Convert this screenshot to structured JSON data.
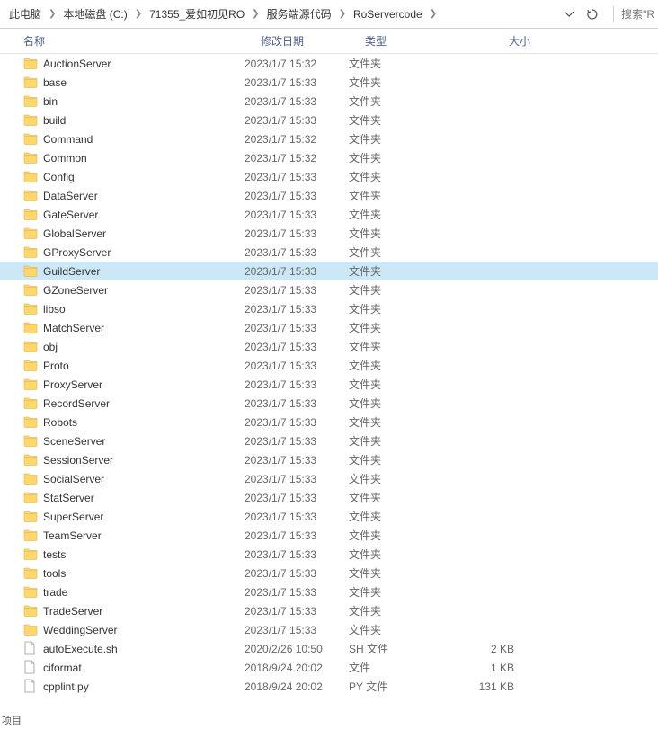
{
  "breadcrumb": {
    "items": [
      "此电脑",
      "本地磁盘 (C:)",
      "71355_爱如初见RO",
      "服务端源代码",
      "RoServercode"
    ]
  },
  "search": {
    "placeholder": "搜索\"R"
  },
  "columns": {
    "name": "名称",
    "date": "修改日期",
    "type": "类型",
    "size": "大小"
  },
  "rows": [
    {
      "icon": "folder",
      "name": "AuctionServer",
      "date": "2023/1/7 15:32",
      "type": "文件夹",
      "size": "",
      "selected": false
    },
    {
      "icon": "folder",
      "name": "base",
      "date": "2023/1/7 15:33",
      "type": "文件夹",
      "size": "",
      "selected": false
    },
    {
      "icon": "folder",
      "name": "bin",
      "date": "2023/1/7 15:33",
      "type": "文件夹",
      "size": "",
      "selected": false
    },
    {
      "icon": "folder",
      "name": "build",
      "date": "2023/1/7 15:33",
      "type": "文件夹",
      "size": "",
      "selected": false
    },
    {
      "icon": "folder",
      "name": "Command",
      "date": "2023/1/7 15:32",
      "type": "文件夹",
      "size": "",
      "selected": false
    },
    {
      "icon": "folder",
      "name": "Common",
      "date": "2023/1/7 15:32",
      "type": "文件夹",
      "size": "",
      "selected": false
    },
    {
      "icon": "folder",
      "name": "Config",
      "date": "2023/1/7 15:33",
      "type": "文件夹",
      "size": "",
      "selected": false
    },
    {
      "icon": "folder",
      "name": "DataServer",
      "date": "2023/1/7 15:33",
      "type": "文件夹",
      "size": "",
      "selected": false
    },
    {
      "icon": "folder",
      "name": "GateServer",
      "date": "2023/1/7 15:33",
      "type": "文件夹",
      "size": "",
      "selected": false
    },
    {
      "icon": "folder",
      "name": "GlobalServer",
      "date": "2023/1/7 15:33",
      "type": "文件夹",
      "size": "",
      "selected": false
    },
    {
      "icon": "folder",
      "name": "GProxyServer",
      "date": "2023/1/7 15:33",
      "type": "文件夹",
      "size": "",
      "selected": false
    },
    {
      "icon": "folder",
      "name": "GuildServer",
      "date": "2023/1/7 15:33",
      "type": "文件夹",
      "size": "",
      "selected": true
    },
    {
      "icon": "folder",
      "name": "GZoneServer",
      "date": "2023/1/7 15:33",
      "type": "文件夹",
      "size": "",
      "selected": false
    },
    {
      "icon": "folder",
      "name": "libso",
      "date": "2023/1/7 15:33",
      "type": "文件夹",
      "size": "",
      "selected": false
    },
    {
      "icon": "folder",
      "name": "MatchServer",
      "date": "2023/1/7 15:33",
      "type": "文件夹",
      "size": "",
      "selected": false
    },
    {
      "icon": "folder",
      "name": "obj",
      "date": "2023/1/7 15:33",
      "type": "文件夹",
      "size": "",
      "selected": false
    },
    {
      "icon": "folder",
      "name": "Proto",
      "date": "2023/1/7 15:33",
      "type": "文件夹",
      "size": "",
      "selected": false
    },
    {
      "icon": "folder",
      "name": "ProxyServer",
      "date": "2023/1/7 15:33",
      "type": "文件夹",
      "size": "",
      "selected": false
    },
    {
      "icon": "folder",
      "name": "RecordServer",
      "date": "2023/1/7 15:33",
      "type": "文件夹",
      "size": "",
      "selected": false
    },
    {
      "icon": "folder",
      "name": "Robots",
      "date": "2023/1/7 15:33",
      "type": "文件夹",
      "size": "",
      "selected": false
    },
    {
      "icon": "folder",
      "name": "SceneServer",
      "date": "2023/1/7 15:33",
      "type": "文件夹",
      "size": "",
      "selected": false
    },
    {
      "icon": "folder",
      "name": "SessionServer",
      "date": "2023/1/7 15:33",
      "type": "文件夹",
      "size": "",
      "selected": false
    },
    {
      "icon": "folder",
      "name": "SocialServer",
      "date": "2023/1/7 15:33",
      "type": "文件夹",
      "size": "",
      "selected": false
    },
    {
      "icon": "folder",
      "name": "StatServer",
      "date": "2023/1/7 15:33",
      "type": "文件夹",
      "size": "",
      "selected": false
    },
    {
      "icon": "folder",
      "name": "SuperServer",
      "date": "2023/1/7 15:33",
      "type": "文件夹",
      "size": "",
      "selected": false
    },
    {
      "icon": "folder",
      "name": "TeamServer",
      "date": "2023/1/7 15:33",
      "type": "文件夹",
      "size": "",
      "selected": false
    },
    {
      "icon": "folder",
      "name": "tests",
      "date": "2023/1/7 15:33",
      "type": "文件夹",
      "size": "",
      "selected": false
    },
    {
      "icon": "folder",
      "name": "tools",
      "date": "2023/1/7 15:33",
      "type": "文件夹",
      "size": "",
      "selected": false
    },
    {
      "icon": "folder",
      "name": "trade",
      "date": "2023/1/7 15:33",
      "type": "文件夹",
      "size": "",
      "selected": false
    },
    {
      "icon": "folder",
      "name": "TradeServer",
      "date": "2023/1/7 15:33",
      "type": "文件夹",
      "size": "",
      "selected": false
    },
    {
      "icon": "folder",
      "name": "WeddingServer",
      "date": "2023/1/7 15:33",
      "type": "文件夹",
      "size": "",
      "selected": false
    },
    {
      "icon": "file",
      "name": "autoExecute.sh",
      "date": "2020/2/26 10:50",
      "type": "SH 文件",
      "size": "2 KB",
      "selected": false
    },
    {
      "icon": "file",
      "name": "ciformat",
      "date": "2018/9/24 20:02",
      "type": "文件",
      "size": "1 KB",
      "selected": false
    },
    {
      "icon": "file",
      "name": "cpplint.py",
      "date": "2018/9/24 20:02",
      "type": "PY 文件",
      "size": "131 KB",
      "selected": false
    }
  ],
  "footer": "项目"
}
